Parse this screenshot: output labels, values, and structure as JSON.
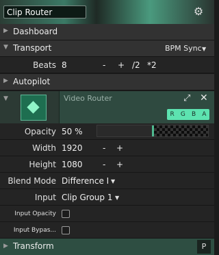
{
  "header": {
    "title": "Clip Router"
  },
  "sections": {
    "dashboard": "Dashboard",
    "transport": "Transport",
    "autopilot": "Autopilot",
    "transform": "Transform"
  },
  "transport": {
    "sync_mode": "BPM Sync",
    "beats_label": "Beats",
    "beats_value": "8",
    "minus": "-",
    "plus": "+",
    "divide": "/2",
    "multiply": "*2"
  },
  "router": {
    "name": "Video Router",
    "rgba": [
      "R",
      "G",
      "B",
      "A"
    ]
  },
  "params": {
    "opacity_label": "Opacity",
    "opacity_value": "50 %",
    "opacity_level": 0.5,
    "width_label": "Width",
    "width_value": "1920",
    "height_label": "Height",
    "height_value": "1080",
    "blend_label": "Blend Mode",
    "blend_value": "Difference I",
    "input_label": "Input",
    "input_value": "Clip Group 1",
    "input_opacity_label": "Input Opacity",
    "input_bypass_label": "Input Bypas..."
  },
  "footer": {
    "p_button": "P"
  },
  "colors": {
    "accent": "#5de3b0",
    "header_green": "#3b7a66"
  }
}
